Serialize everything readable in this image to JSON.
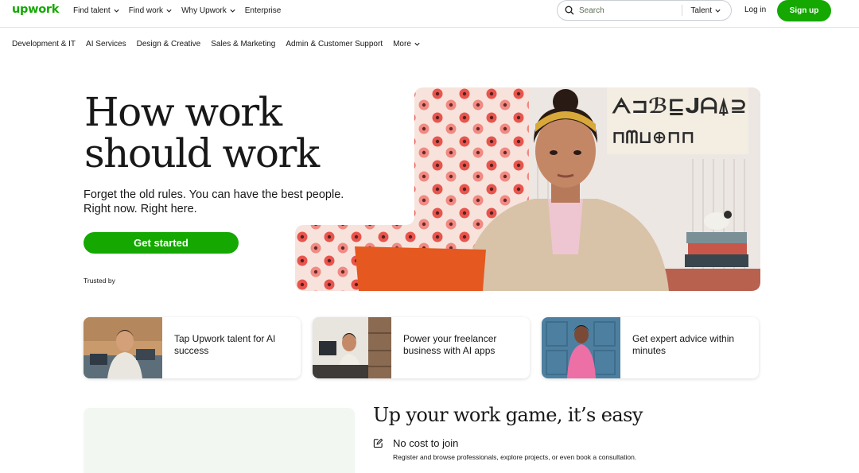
{
  "header": {
    "logo": "upwork",
    "nav": [
      {
        "label": "Find talent",
        "dropdown": true
      },
      {
        "label": "Find work",
        "dropdown": true
      },
      {
        "label": "Why Upwork",
        "dropdown": true
      },
      {
        "label": "Enterprise",
        "dropdown": false
      }
    ],
    "search_placeholder": "Search",
    "search_category": "Talent",
    "login": "Log in",
    "signup": "Sign up"
  },
  "categories": {
    "items": [
      "Development & IT",
      "AI Services",
      "Design & Creative",
      "Sales & Marketing",
      "Admin & Customer Support"
    ],
    "more": "More"
  },
  "hero": {
    "title_line1": "How work",
    "title_line2": "should work",
    "subtitle_line1": "Forget the old rules. You can have the best people.",
    "subtitle_line2": "Right now. Right here.",
    "cta": "Get started",
    "trusted_by": "Trusted by"
  },
  "cards": [
    {
      "text": "Tap Upwork talent for AI success"
    },
    {
      "text": "Power your freelancer business with AI apps"
    },
    {
      "text": "Get expert advice within minutes"
    }
  ],
  "section": {
    "title": "Up your work game, it’s easy",
    "feature_title": "No cost to join",
    "feature_desc": "Register and browse professionals, explore projects, or even book a consultation."
  },
  "colors": {
    "brand_green": "#14a800",
    "text": "#181818",
    "panel_bg": "#f2f7f2"
  },
  "icons": [
    "search-icon",
    "chevron-down-icon",
    "edit-icon"
  ]
}
